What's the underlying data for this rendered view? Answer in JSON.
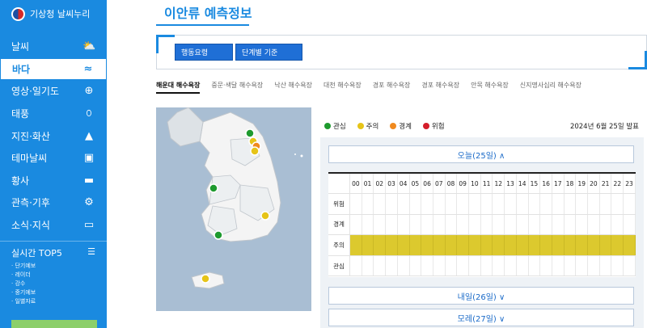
{
  "sidebar": {
    "logo_text": "기상청 날씨누리",
    "items": [
      {
        "label": "날씨",
        "icon": "weather-icon"
      },
      {
        "label": "바다",
        "icon": "sea-icon",
        "active": true
      },
      {
        "label": "영상·일기도",
        "icon": "globe-icon"
      },
      {
        "label": "태풍",
        "icon": "typhoon-icon"
      },
      {
        "label": "지진·화산",
        "icon": "earthquake-icon"
      },
      {
        "label": "테마날씨",
        "icon": "suitcase-icon"
      },
      {
        "label": "황사",
        "icon": "dust-icon"
      },
      {
        "label": "관측·기후",
        "icon": "observation-icon"
      },
      {
        "label": "소식·지식",
        "icon": "news-icon"
      }
    ],
    "top5": {
      "title": "실시간 TOP5",
      "items": [
        "· 단기예보",
        "· 레이더",
        "· 강수",
        "· 중기예보",
        "· 일별자료"
      ]
    }
  },
  "main": {
    "title": "이안류 예측정보",
    "buttons": [
      "행동요령",
      "단계별 기준"
    ],
    "tabs": [
      "해운대 해수욕장",
      "중문·색달 해수욕장",
      "낙산 해수욕장",
      "대천 해수욕장",
      "경포 해수욕장",
      "경포 해수욕장",
      "안목 해수욕장",
      "신지명사십리 해수욕장"
    ]
  },
  "legend": [
    {
      "label": "관심",
      "color": "#1e9a2e"
    },
    {
      "label": "주의",
      "color": "#e6c418"
    },
    {
      "label": "경계",
      "color": "#f08a1e"
    },
    {
      "label": "위험",
      "color": "#d41e2a"
    }
  ],
  "issue_date": "2024년 6월 25일 발표",
  "forecast": {
    "today_label": "오늘(25일) ∧",
    "tomorrow_label": "내일(26일) ∨",
    "dayafter_label": "모레(27일) ∨",
    "hours": [
      "00",
      "01",
      "02",
      "03",
      "04",
      "05",
      "06",
      "07",
      "08",
      "09",
      "10",
      "11",
      "12",
      "13",
      "14",
      "15",
      "16",
      "17",
      "18",
      "19",
      "20",
      "21",
      "22",
      "23"
    ],
    "levels": [
      "위험",
      "경계",
      "주의",
      "관심"
    ],
    "active_level": "주의",
    "active_color": "#dcc92e"
  }
}
